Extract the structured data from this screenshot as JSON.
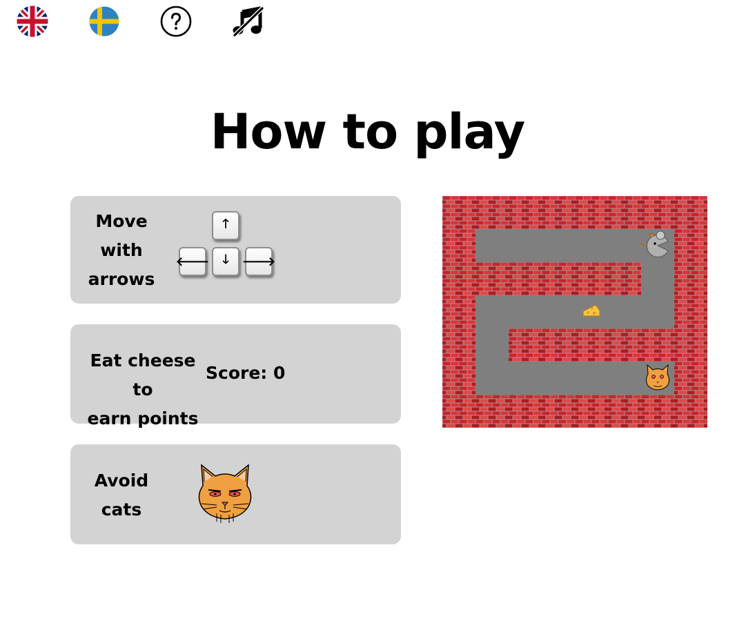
{
  "toolbar": {
    "items": [
      {
        "name": "english-flag-icon",
        "label": "English"
      },
      {
        "name": "swedish-flag-icon",
        "label": "Swedish"
      },
      {
        "name": "help-icon",
        "label": "Help"
      },
      {
        "name": "music-off-icon",
        "label": "Music off"
      }
    ]
  },
  "title": "How to play",
  "instructions": {
    "move_text": "Move\nwith\narrows",
    "keys": {
      "up": "🡑",
      "left": "🡐",
      "down": "🡓",
      "right": "🡒"
    },
    "cheese_text": "Eat cheese to\nearn points",
    "score_label": "Score: 0",
    "avoid_text": "Avoid\ncats"
  },
  "maze_demo": {
    "grid_size": [
      8,
      7
    ],
    "sprites": [
      "mouse",
      "cheese",
      "cat"
    ]
  },
  "colors": {
    "card_bg": "#d3d3d3",
    "floor": "#7f7f7f",
    "brick": "#c8232b",
    "mortar": "#b98c8c",
    "cat": "#f0a040",
    "cheese": "#f6c341",
    "mouse": "#b0b0b0"
  }
}
